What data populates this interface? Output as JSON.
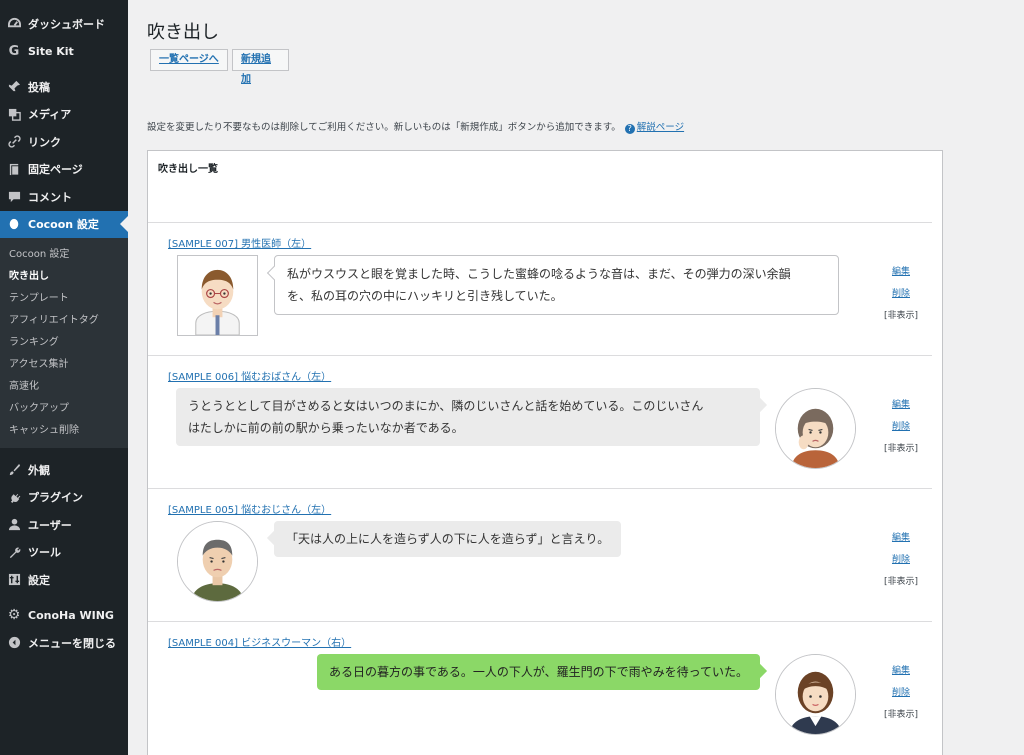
{
  "sidebar": {
    "items": [
      {
        "label": "ダッシュボード",
        "icon": "dashboard-icon"
      },
      {
        "label": "Site Kit",
        "icon": "google-g-icon"
      },
      {
        "label": "投稿",
        "icon": "pin-icon"
      },
      {
        "label": "メディア",
        "icon": "media-icon"
      },
      {
        "label": "リンク",
        "icon": "link-icon"
      },
      {
        "label": "固定ページ",
        "icon": "page-icon"
      },
      {
        "label": "コメント",
        "icon": "comment-icon"
      },
      {
        "label": "Cocoon 設定",
        "icon": "cocoon-icon",
        "active": true
      }
    ],
    "submenu": [
      {
        "label": "Cocoon 設定"
      },
      {
        "label": "吹き出し",
        "current": true
      },
      {
        "label": "テンプレート"
      },
      {
        "label": "アフィリエイトタグ"
      },
      {
        "label": "ランキング"
      },
      {
        "label": "アクセス集計"
      },
      {
        "label": "高速化"
      },
      {
        "label": "バックアップ"
      },
      {
        "label": "キャッシュ削除"
      }
    ],
    "items2": [
      {
        "label": "外観",
        "icon": "brush-icon"
      },
      {
        "label": "プラグイン",
        "icon": "plugin-icon"
      },
      {
        "label": "ユーザー",
        "icon": "user-icon"
      },
      {
        "label": "ツール",
        "icon": "wrench-icon"
      },
      {
        "label": "設定",
        "icon": "settings-icon"
      }
    ],
    "items3": [
      {
        "label": "ConoHa WING",
        "icon": "gear-icon"
      },
      {
        "label": "メニューを閉じる",
        "icon": "collapse-icon"
      }
    ]
  },
  "page": {
    "title": "吹き出し",
    "list_button": "一覧ページへ",
    "new_button": "新規追加",
    "notice": "設定を変更したり不要なものは削除してご利用ください。新しいものは「新規作成」ボタンから追加できます。",
    "help_link": "解説ページ",
    "panel_title": "吹き出し一覧"
  },
  "entries": [
    {
      "title": "[SAMPLE 007] 男性医師（左）",
      "text_line1": "私がウスウスと眼を覚ました時、こうした蜜蜂の唸るような音は、まだ、その弾力の深い余韻",
      "text_line2": "を、私の耳の穴の中にハッキリと引き残していた。",
      "avatar": "male-doctor-avatar",
      "edit": "編集",
      "delete": "削除",
      "hidden": "[非表示]"
    },
    {
      "title": "[SAMPLE 006] 悩むおばさん（左）",
      "text_line1": "うとうととして目がさめると女はいつのまにか、隣のじいさんと話を始めている。このじいさん",
      "text_line2": "はたしかに前の前の駅から乗ったいなか者である。",
      "avatar": "worried-woman-avatar",
      "edit": "編集",
      "delete": "削除",
      "hidden": "[非表示]"
    },
    {
      "title": "[SAMPLE 005] 悩むおじさん（左）",
      "text_line1": "「天は人の上に人を造らず人の下に人を造らず」と言えり。",
      "text_line2": "",
      "avatar": "worried-man-avatar",
      "edit": "編集",
      "delete": "削除",
      "hidden": "[非表示]"
    },
    {
      "title": "[SAMPLE 004] ビジネスウーマン（右）",
      "text_line1": "ある日の暮方の事である。一人の下人が、羅生門の下で雨やみを待っていた。",
      "text_line2": "",
      "avatar": "business-woman-avatar",
      "edit": "編集",
      "delete": "削除",
      "hidden": "[非表示]"
    }
  ],
  "colors": {
    "sidebar_bg": "#1d2327",
    "accent": "#2271b1",
    "green_bubble": "#8bd867"
  }
}
